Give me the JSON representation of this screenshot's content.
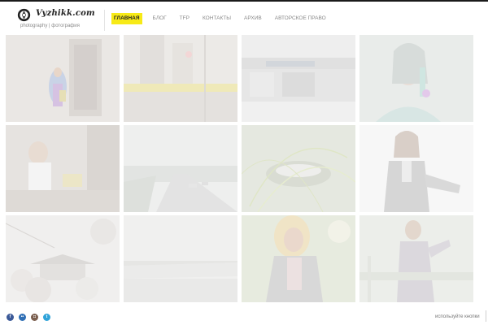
{
  "site": {
    "name": "Vyzhikk.com",
    "tagline": "photography | фотография"
  },
  "nav": {
    "items": [
      {
        "label": "Главная",
        "active": true
      },
      {
        "label": "Блог",
        "active": false
      },
      {
        "label": "TFP",
        "active": false
      },
      {
        "label": "Контакты",
        "active": false
      },
      {
        "label": "Архив",
        "active": false
      },
      {
        "label": "Авторское право",
        "active": false
      }
    ]
  },
  "gallery": {
    "photos": [
      {
        "subject": "girl in colorful coat by doorway"
      },
      {
        "subject": "street through window, yellow bus"
      },
      {
        "subject": "london beer wine storefront"
      },
      {
        "subject": "woman with teal scarf and purple earring"
      },
      {
        "subject": "woman in white blouse by window"
      },
      {
        "subject": "rainy road with cars"
      },
      {
        "subject": "grass stems over rock"
      },
      {
        "subject": "woman in black jacket"
      },
      {
        "subject": "cherry blossoms over pagoda roof"
      },
      {
        "subject": "foggy lake shore"
      },
      {
        "subject": "blonde woman with sun flare"
      },
      {
        "subject": "man in gray trench coat"
      }
    ]
  },
  "footer": {
    "social": [
      {
        "icon": "facebook-icon",
        "color": "#3b5998"
      },
      {
        "icon": "flickr-icon",
        "color": "#2f6fb5"
      },
      {
        "icon": "instagram-icon",
        "color": "#7a5e4e"
      },
      {
        "icon": "twitter-icon",
        "color": "#2fa3d9"
      }
    ],
    "note": "используйте кнопки"
  },
  "colors": {
    "active_nav": "#f7ea17",
    "top_bar": "#1a1a1a"
  }
}
